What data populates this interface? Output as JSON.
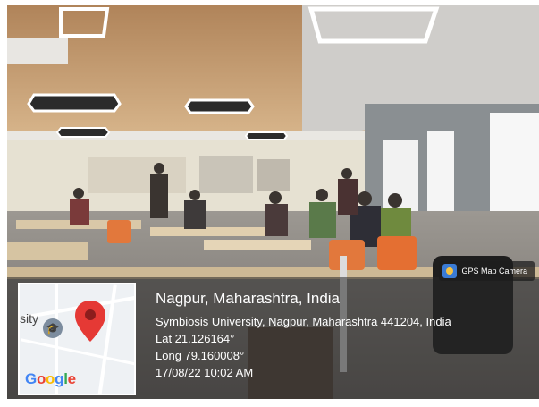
{
  "badge": {
    "label": "GPS Map Camera",
    "icon": "gps-map-camera-icon"
  },
  "location": {
    "city_line": "Nagpur, Maharashtra, India",
    "address": "Symbiosis University, Nagpur, Maharashtra 441204, India",
    "lat": "Lat 21.126164°",
    "long": "Long 79.160008°",
    "datetime": "17/08/22 10:02 AM"
  },
  "map": {
    "partial_label": "sity",
    "logo": [
      "G",
      "o",
      "o",
      "g",
      "l",
      "e"
    ],
    "logo_colors": [
      "#4285F4",
      "#EA4335",
      "#FBBC05",
      "#4285F4",
      "#34A853",
      "#EA4335"
    ],
    "pin_color": "#E53935"
  }
}
